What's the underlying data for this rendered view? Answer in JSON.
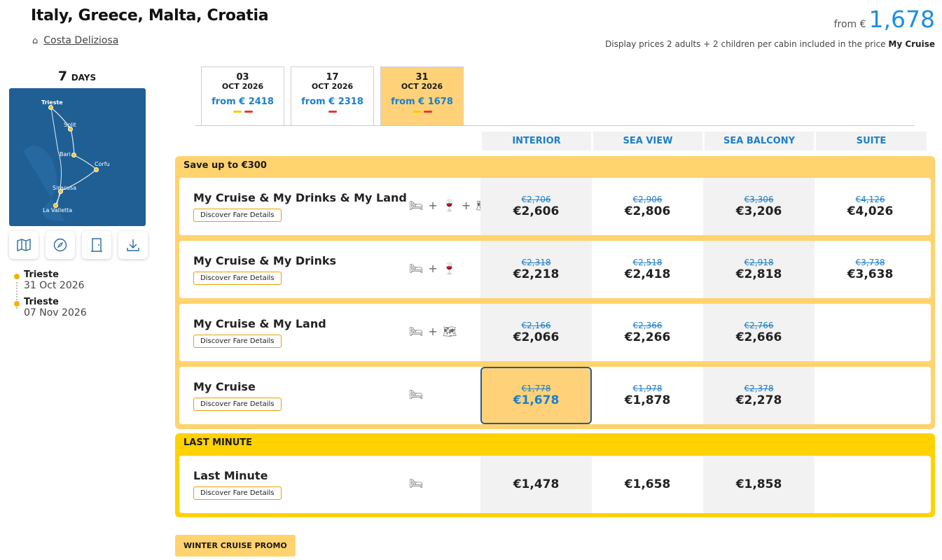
{
  "header": {
    "title": "Italy, Greece, Malta, Croatia",
    "ship": "Costa Deliziosa",
    "price_prefix": "from €",
    "price_amount": "1,678",
    "display_note_text": "Display prices 2 adults + 2 children per cabin included in the price",
    "display_note_bold": "My Cruise"
  },
  "trip": {
    "days_num": "7",
    "days_unit": "DAYS",
    "map_ports": [
      "Trieste",
      "Split",
      "Bari",
      "Corfu",
      "Siracusa",
      "La Valletta"
    ],
    "toolbar_icons": [
      "map-icon",
      "compass-icon",
      "door-icon",
      "download-icon"
    ],
    "itinerary": [
      {
        "port": "Trieste",
        "date": "31 Oct 2026"
      },
      {
        "port": "Trieste",
        "date": "07 Nov 2026"
      }
    ]
  },
  "date_tabs": [
    {
      "day": "03",
      "month": "OCT 2026",
      "price": "from € 2418",
      "marks": [
        "#f5d000",
        "#e53935"
      ],
      "active": false
    },
    {
      "day": "17",
      "month": "OCT 2026",
      "price": "from € 2318",
      "marks": [
        "#e53935"
      ],
      "active": false
    },
    {
      "day": "31",
      "month": "OCT 2026",
      "price": "from € 1678",
      "marks": [
        "#f5d000",
        "#e53935"
      ],
      "active": true
    }
  ],
  "columns": [
    "INTERIOR",
    "SEA VIEW",
    "SEA BALCONY",
    "SUITE"
  ],
  "sections": {
    "save": {
      "title": "Save up to €300",
      "rows": [
        {
          "name": "My Cruise & My Drinks & My Land",
          "button": "Discover Fare Details",
          "icons": "🛏 + 🍷 + 🗺",
          "prices": [
            {
              "old": "€2,706",
              "new": "€2,606"
            },
            {
              "old": "€2,906",
              "new": "€2,806"
            },
            {
              "old": "€3,306",
              "new": "€3,206"
            },
            {
              "old": "€4,126",
              "new": "€4,026"
            }
          ]
        },
        {
          "name": "My Cruise & My Drinks",
          "button": "Discover Fare Details",
          "icons": "🛏 + 🍷",
          "prices": [
            {
              "old": "€2,318",
              "new": "€2,218"
            },
            {
              "old": "€2,518",
              "new": "€2,418"
            },
            {
              "old": "€2,918",
              "new": "€2,818"
            },
            {
              "old": "€3,738",
              "new": "€3,638"
            }
          ]
        },
        {
          "name": "My Cruise & My Land",
          "button": "Discover Fare Details",
          "icons": "🛏 + 🗺",
          "prices": [
            {
              "old": "€2,166",
              "new": "€2,066"
            },
            {
              "old": "€2,366",
              "new": "€2,266"
            },
            {
              "old": "€2,766",
              "new": "€2,666"
            }
          ]
        },
        {
          "name": "My Cruise",
          "button": "Discover Fare Details",
          "icons": "🛏",
          "prices": [
            {
              "old": "€1,778",
              "new": "€1,678"
            },
            {
              "old": "€1,978",
              "new": "€1,878"
            },
            {
              "old": "€2,378",
              "new": "€2,278"
            }
          ]
        }
      ]
    },
    "last_minute": {
      "title": "LAST MINUTE",
      "rows": [
        {
          "name": "Last Minute",
          "button": "Discover Fare Details",
          "icons": "🛏",
          "prices": [
            {
              "new": "€1,478"
            },
            {
              "new": "€1,658"
            },
            {
              "new": "€1,858"
            }
          ]
        }
      ]
    }
  },
  "promo": "WINTER CRUISE PROMO",
  "colors": {
    "accent_blue": "#1c7fc8",
    "section_yellow": "#ffd36e",
    "last_minute_yellow": "#ffd200",
    "selected_border": "#1f5f94"
  }
}
